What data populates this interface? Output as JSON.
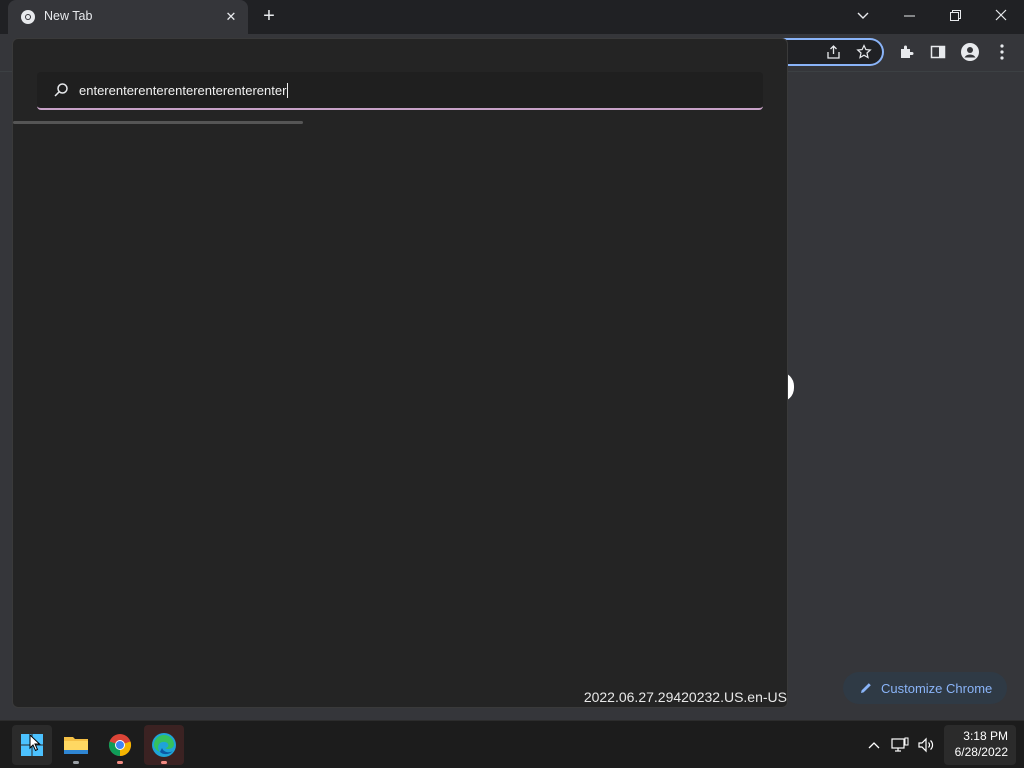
{
  "tab": {
    "title": "New Tab",
    "close_glyph": "✕"
  },
  "newtab_glyph": "+",
  "window_controls": {
    "dropdown": "⌄",
    "minimize": "—",
    "restore": "❐",
    "close": "✕"
  },
  "search": {
    "value": "enterenterenterenterenterenterenter"
  },
  "version": "2022.06.27.29420232.US.en-US",
  "customize": {
    "label": "Customize Chrome"
  },
  "taskbar": {
    "apps": [
      "start",
      "file-explorer",
      "chrome",
      "edge"
    ],
    "clock_time": "3:18 PM",
    "clock_date": "6/28/2022"
  },
  "colors": {
    "accent": "#8ab4f8",
    "focus_underline": "#c8a2c8",
    "panel": "#242424"
  }
}
